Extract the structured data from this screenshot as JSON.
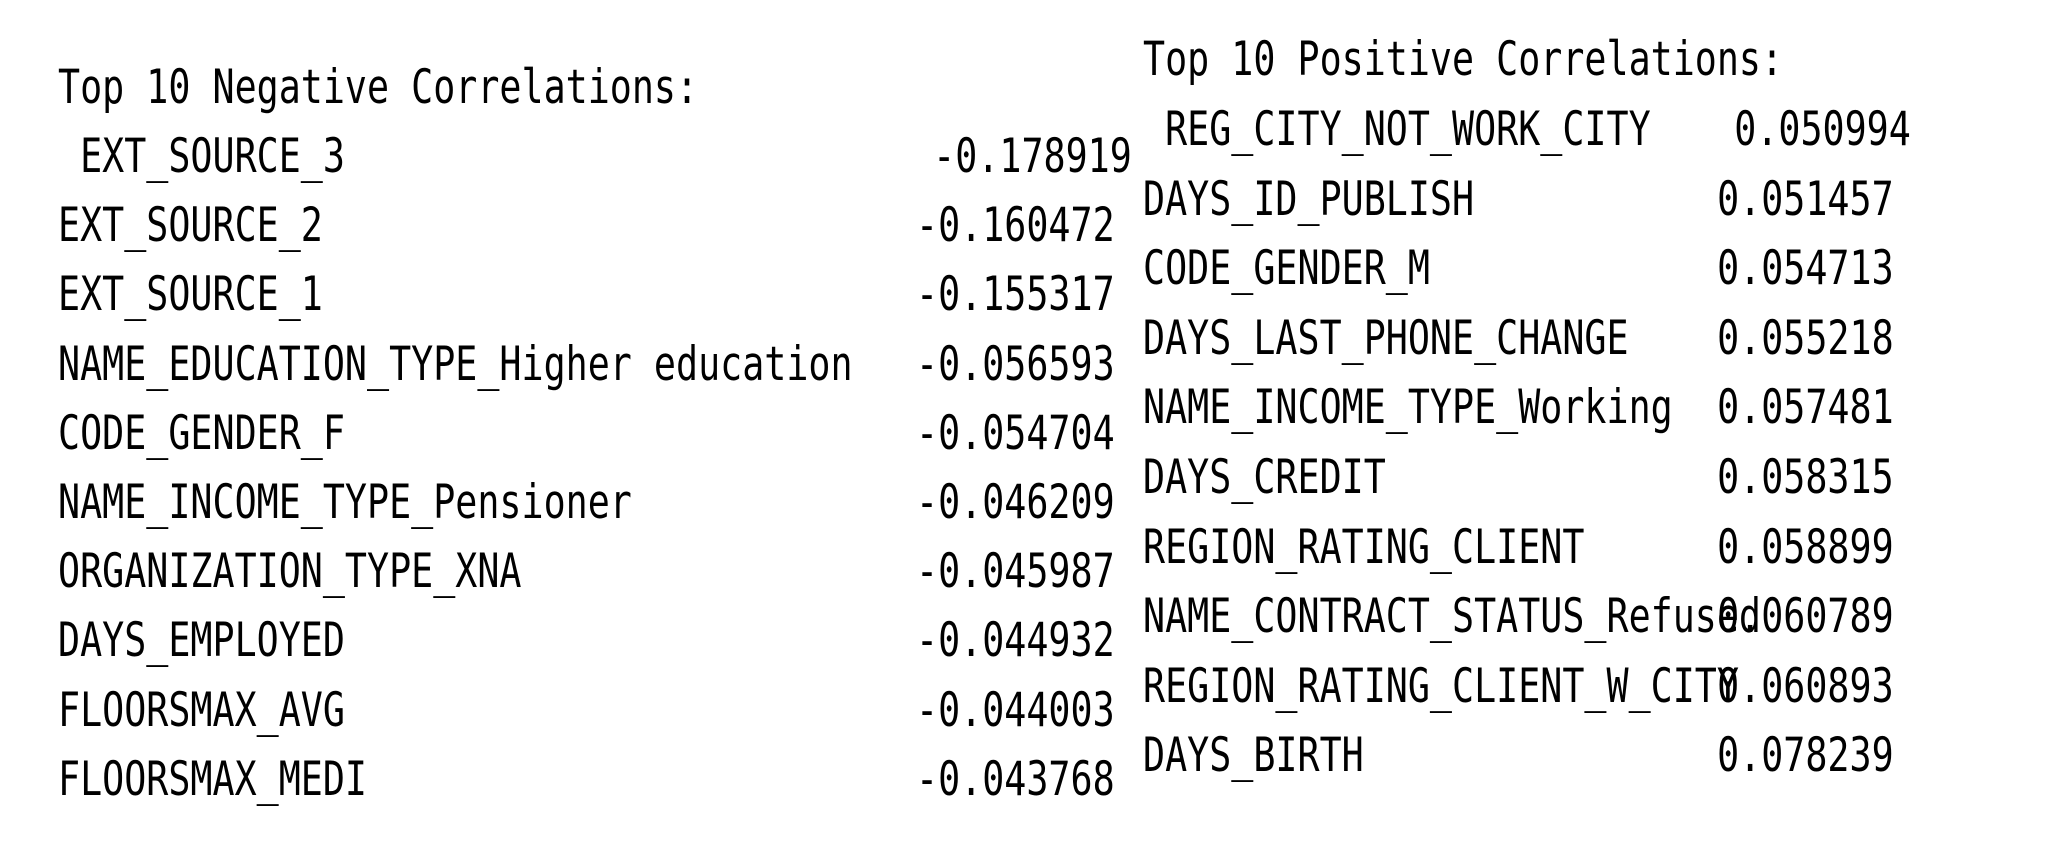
{
  "negative": {
    "title": "Top 10 Negative Correlations:",
    "rows": [
      {
        "name": " EXT_SOURCE_3",
        "value": "-0.178919"
      },
      {
        "name": "EXT_SOURCE_2",
        "value": "-0.160472"
      },
      {
        "name": "EXT_SOURCE_1",
        "value": "-0.155317"
      },
      {
        "name": "NAME_EDUCATION_TYPE_Higher education",
        "value": "-0.056593"
      },
      {
        "name": "CODE_GENDER_F",
        "value": "-0.054704"
      },
      {
        "name": "NAME_INCOME_TYPE_Pensioner",
        "value": "-0.046209"
      },
      {
        "name": "ORGANIZATION_TYPE_XNA",
        "value": "-0.045987"
      },
      {
        "name": "DAYS_EMPLOYED",
        "value": "-0.044932"
      },
      {
        "name": "FLOORSMAX_AVG",
        "value": "-0.044003"
      },
      {
        "name": "FLOORSMAX_MEDI",
        "value": "-0.043768"
      }
    ]
  },
  "positive": {
    "title": "Top 10 Positive Correlations:",
    "rows": [
      {
        "name": " REG_CITY_NOT_WORK_CITY",
        "value": "0.050994"
      },
      {
        "name": "DAYS_ID_PUBLISH",
        "value": "0.051457"
      },
      {
        "name": "CODE_GENDER_M",
        "value": "0.054713"
      },
      {
        "name": "DAYS_LAST_PHONE_CHANGE",
        "value": "0.055218"
      },
      {
        "name": "NAME_INCOME_TYPE_Working",
        "value": "0.057481"
      },
      {
        "name": "DAYS_CREDIT",
        "value": "0.058315"
      },
      {
        "name": "REGION_RATING_CLIENT",
        "value": "0.058899"
      },
      {
        "name": "NAME_CONTRACT_STATUS_Refused",
        "value": "0.060789"
      },
      {
        "name": "REGION_RATING_CLIENT_W_CITY",
        "value": "0.060893"
      },
      {
        "name": "DAYS_BIRTH",
        "value": "0.078239"
      }
    ]
  }
}
